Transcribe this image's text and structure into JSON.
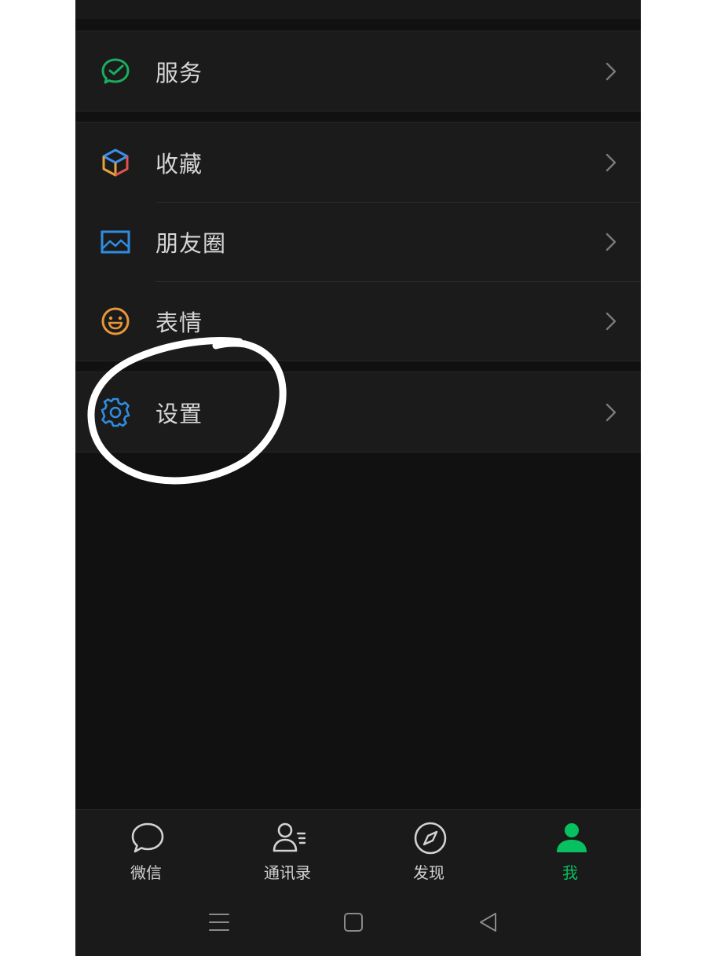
{
  "menu": {
    "groups": [
      {
        "items": [
          {
            "label": "服务",
            "icon": "service-icon"
          }
        ]
      },
      {
        "items": [
          {
            "label": "收藏",
            "icon": "favorites-cube-icon"
          },
          {
            "label": "朋友圈",
            "icon": "moments-picture-icon"
          },
          {
            "label": "表情",
            "icon": "sticker-smile-icon"
          }
        ]
      },
      {
        "items": [
          {
            "label": "设置",
            "icon": "settings-gear-icon"
          }
        ]
      }
    ]
  },
  "tabbar": {
    "tabs": [
      {
        "label": "微信",
        "icon": "chat-bubble-icon",
        "active": false
      },
      {
        "label": "通讯录",
        "icon": "contacts-icon",
        "active": false
      },
      {
        "label": "发现",
        "icon": "compass-icon",
        "active": false
      },
      {
        "label": "我",
        "icon": "person-icon",
        "active": true
      }
    ]
  },
  "colors": {
    "accent": "#07c160",
    "service_icon": "#1aad5e",
    "favorites_icon": [
      "#3d8ee8",
      "#e8a23a",
      "#e0534a"
    ],
    "moments_icon": "#2f8de0",
    "sticker_icon": "#e7963a",
    "settings_icon": "#2f8de0",
    "annotation": "#ffffff"
  },
  "system_nav": {
    "buttons": [
      "menu-icon",
      "home-square-icon",
      "back-triangle-icon"
    ]
  }
}
